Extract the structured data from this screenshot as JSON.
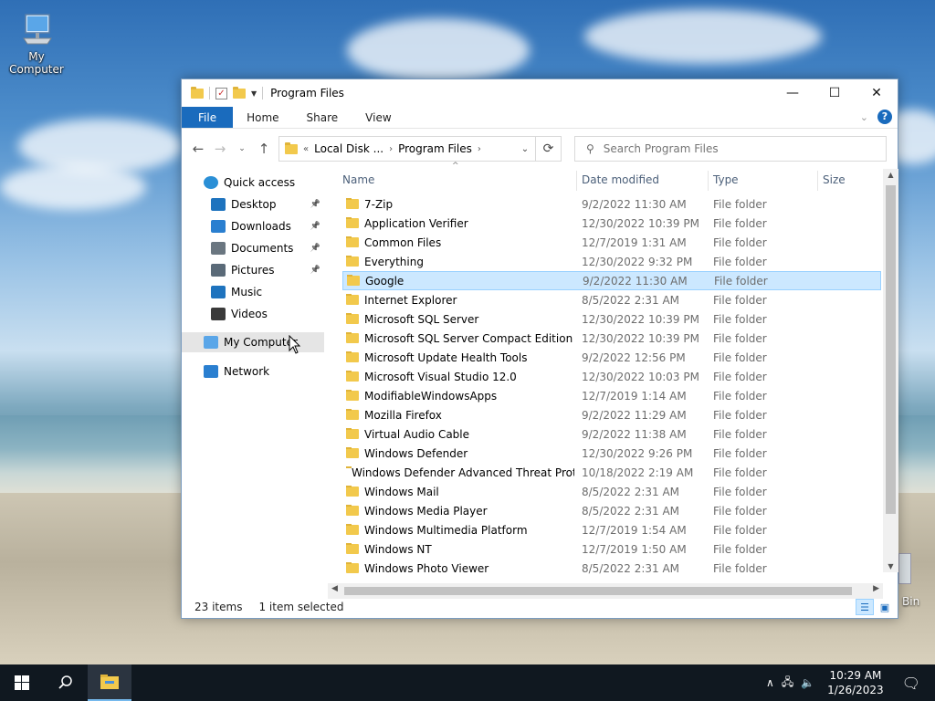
{
  "desktop": {
    "icons": [
      {
        "label": "My Computer"
      },
      {
        "label": "Bin"
      }
    ]
  },
  "window": {
    "title": "Program Files",
    "controls": {
      "minimize": "—",
      "maximize": "☐",
      "close": "✕"
    },
    "ribbon_tabs": [
      "File",
      "Home",
      "Share",
      "View"
    ],
    "address": {
      "overflow": "«",
      "crumbs": [
        "Local Disk ...",
        "Program Files"
      ]
    },
    "search": {
      "placeholder": "Search Program Files"
    },
    "nav_pane": [
      {
        "label": "Quick access",
        "icon": "star-icon",
        "pinned": false
      },
      {
        "label": "Desktop",
        "icon": "desktop-icon",
        "pinned": true
      },
      {
        "label": "Downloads",
        "icon": "downloads-icon",
        "pinned": true
      },
      {
        "label": "Documents",
        "icon": "documents-icon",
        "pinned": true
      },
      {
        "label": "Pictures",
        "icon": "pictures-icon",
        "pinned": true
      },
      {
        "label": "Music",
        "icon": "music-icon",
        "pinned": false
      },
      {
        "label": "Videos",
        "icon": "videos-icon",
        "pinned": false
      },
      {
        "label": "My Computer",
        "icon": "computer-icon",
        "pinned": false
      },
      {
        "label": "Network",
        "icon": "network-icon",
        "pinned": false
      }
    ],
    "columns": [
      "Name",
      "Date modified",
      "Type",
      "Size"
    ],
    "files": [
      {
        "name": "7-Zip",
        "date": "9/2/2022 11:30 AM",
        "type": "File folder"
      },
      {
        "name": "Application Verifier",
        "date": "12/30/2022 10:39 PM",
        "type": "File folder"
      },
      {
        "name": "Common Files",
        "date": "12/7/2019 1:31 AM",
        "type": "File folder"
      },
      {
        "name": "Everything",
        "date": "12/30/2022 9:32 PM",
        "type": "File folder"
      },
      {
        "name": "Google",
        "date": "9/2/2022 11:30 AM",
        "type": "File folder"
      },
      {
        "name": "Internet Explorer",
        "date": "8/5/2022 2:31 AM",
        "type": "File folder"
      },
      {
        "name": "Microsoft SQL Server",
        "date": "12/30/2022 10:39 PM",
        "type": "File folder"
      },
      {
        "name": "Microsoft SQL Server Compact Edition",
        "date": "12/30/2022 10:39 PM",
        "type": "File folder"
      },
      {
        "name": "Microsoft Update Health Tools",
        "date": "9/2/2022 12:56 PM",
        "type": "File folder"
      },
      {
        "name": "Microsoft Visual Studio 12.0",
        "date": "12/30/2022 10:03 PM",
        "type": "File folder"
      },
      {
        "name": "ModifiableWindowsApps",
        "date": "12/7/2019 1:14 AM",
        "type": "File folder"
      },
      {
        "name": "Mozilla Firefox",
        "date": "9/2/2022 11:29 AM",
        "type": "File folder"
      },
      {
        "name": "Virtual Audio Cable",
        "date": "9/2/2022 11:38 AM",
        "type": "File folder"
      },
      {
        "name": "Windows Defender",
        "date": "12/30/2022 9:26 PM",
        "type": "File folder"
      },
      {
        "name": "Windows Defender Advanced Threat Prot...",
        "date": "10/18/2022 2:19 AM",
        "type": "File folder"
      },
      {
        "name": "Windows Mail",
        "date": "8/5/2022 2:31 AM",
        "type": "File folder"
      },
      {
        "name": "Windows Media Player",
        "date": "8/5/2022 2:31 AM",
        "type": "File folder"
      },
      {
        "name": "Windows Multimedia Platform",
        "date": "12/7/2019 1:54 AM",
        "type": "File folder"
      },
      {
        "name": "Windows NT",
        "date": "12/7/2019 1:50 AM",
        "type": "File folder"
      },
      {
        "name": "Windows Photo Viewer",
        "date": "8/5/2022 2:31 AM",
        "type": "File folder"
      }
    ],
    "selected_index": 4,
    "status": {
      "count": "23 items",
      "selection": "1 item selected"
    }
  },
  "taskbar": {
    "time": "10:29 AM",
    "date": "1/26/2023"
  },
  "colors": {
    "accent": "#1a6bbd",
    "selection": "#cce8ff",
    "folder": "#f2c94c"
  }
}
